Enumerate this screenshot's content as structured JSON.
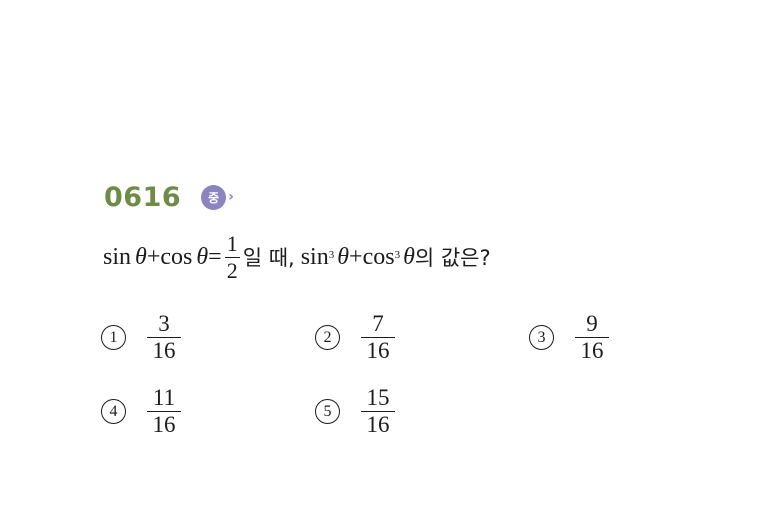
{
  "problem": {
    "number": "0616",
    "difficulty": "중",
    "difficulty_arrow": "›"
  },
  "question": {
    "p1": "sin",
    "theta": "θ",
    "plus": "+",
    "cos": "cos",
    "equals": "=",
    "given_num": "1",
    "given_den": "2",
    "condition_word": "일 때,",
    "sin": "sin",
    "cube": "3",
    "possessive": "의 값은?"
  },
  "choices": [
    {
      "marker": "1",
      "numerator": "3",
      "denominator": "16"
    },
    {
      "marker": "2",
      "numerator": "7",
      "denominator": "16"
    },
    {
      "marker": "3",
      "numerator": "9",
      "denominator": "16"
    },
    {
      "marker": "4",
      "numerator": "11",
      "denominator": "16"
    },
    {
      "marker": "5",
      "numerator": "15",
      "denominator": "16"
    }
  ]
}
